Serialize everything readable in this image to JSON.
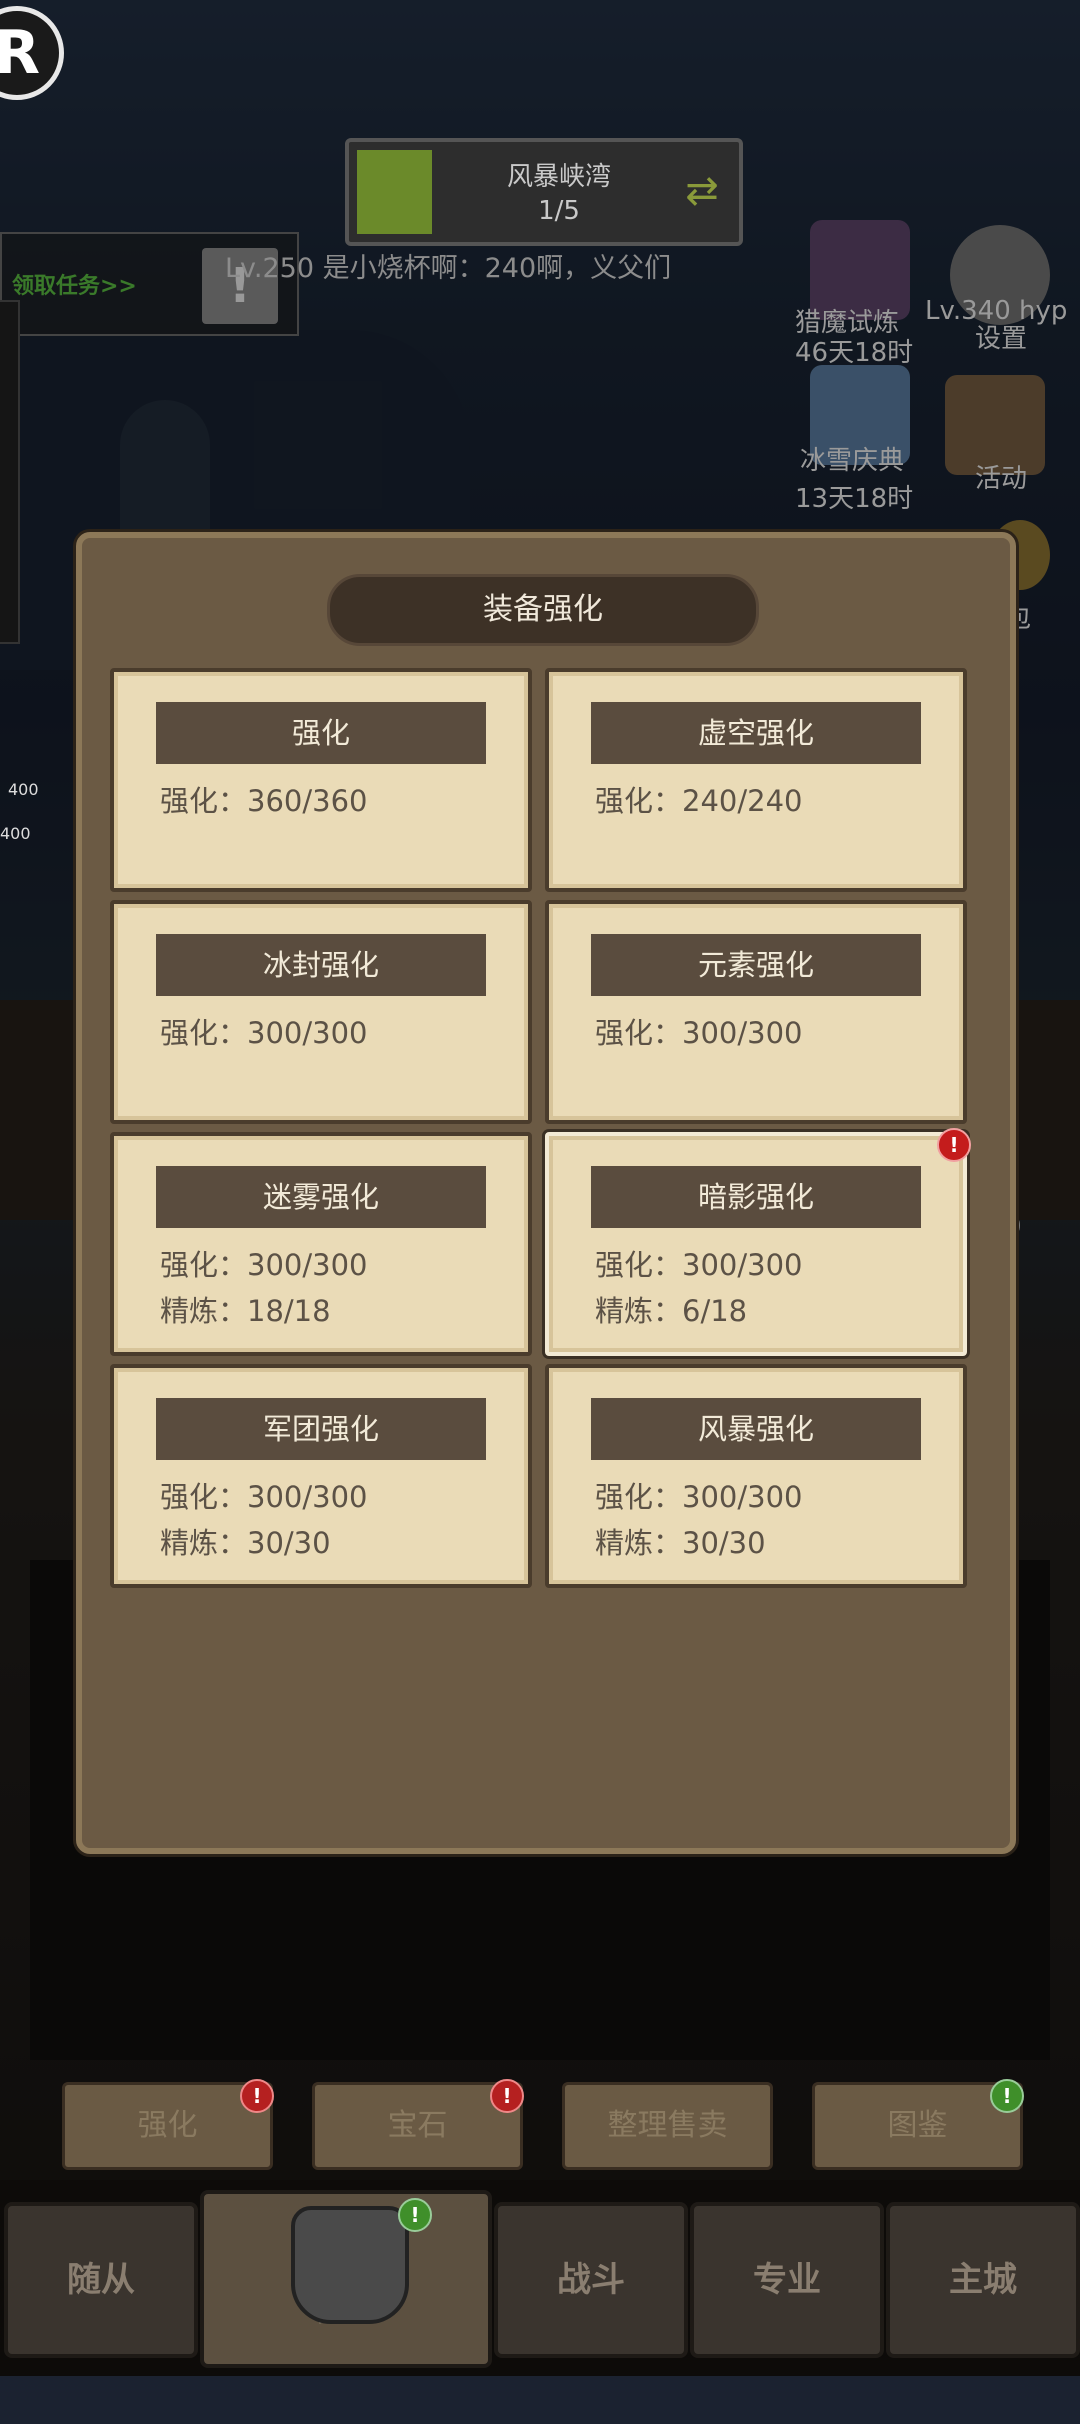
{
  "hud": {
    "stage_name": "风暴峡湾",
    "stage_progress": "1/5",
    "task_label": "领取任务>>",
    "chat_message": "Lv.250 是小烧杯啊：240啊，义父们",
    "events": [
      {
        "label": "猎魔试炼",
        "timer": "46天18时"
      },
      {
        "label": "冰雪庆典",
        "timer": "13天18时"
      }
    ],
    "settings_label": "设置",
    "settings_overlay": "Lv.340 hyp",
    "activity_label": "活动",
    "bag_label": "包",
    "hp_values": [
      "400",
      "400"
    ],
    "right_count": "0"
  },
  "modal": {
    "title": "装备强化",
    "cards": [
      {
        "name": "强化",
        "lines": [
          "强化：360/360"
        ]
      },
      {
        "name": "虚空强化",
        "lines": [
          "强化：240/240"
        ]
      },
      {
        "name": "冰封强化",
        "lines": [
          "强化：300/300"
        ]
      },
      {
        "name": "元素强化",
        "lines": [
          "强化：300/300"
        ]
      },
      {
        "name": "迷雾强化",
        "lines": [
          "强化：300/300",
          "精炼：18/18"
        ]
      },
      {
        "name": "暗影强化",
        "lines": [
          "强化：300/300",
          "精炼：6/18"
        ],
        "alert": "!"
      },
      {
        "name": "军团强化",
        "lines": [
          "强化：300/300",
          "精炼：30/30"
        ]
      },
      {
        "name": "风暴强化",
        "lines": [
          "强化：300/300",
          "精炼：30/30"
        ]
      }
    ]
  },
  "sub_buttons": [
    {
      "label": "强化",
      "badge": "!"
    },
    {
      "label": "宝石",
      "badge": "!"
    },
    {
      "label": "整理售卖"
    },
    {
      "label": "图鉴",
      "badge": "!"
    }
  ],
  "nav": [
    {
      "label": "随从"
    },
    {
      "label": "装备",
      "badge": "!"
    },
    {
      "label": "战斗"
    },
    {
      "label": "专业"
    },
    {
      "label": "主城"
    }
  ],
  "colors": {
    "modal_bg": "#6b5a44",
    "card_bg": "#eadbb7",
    "card_header": "#5a4c3e",
    "alert_red": "#c41c1c",
    "badge_green": "#3f8f2a"
  }
}
